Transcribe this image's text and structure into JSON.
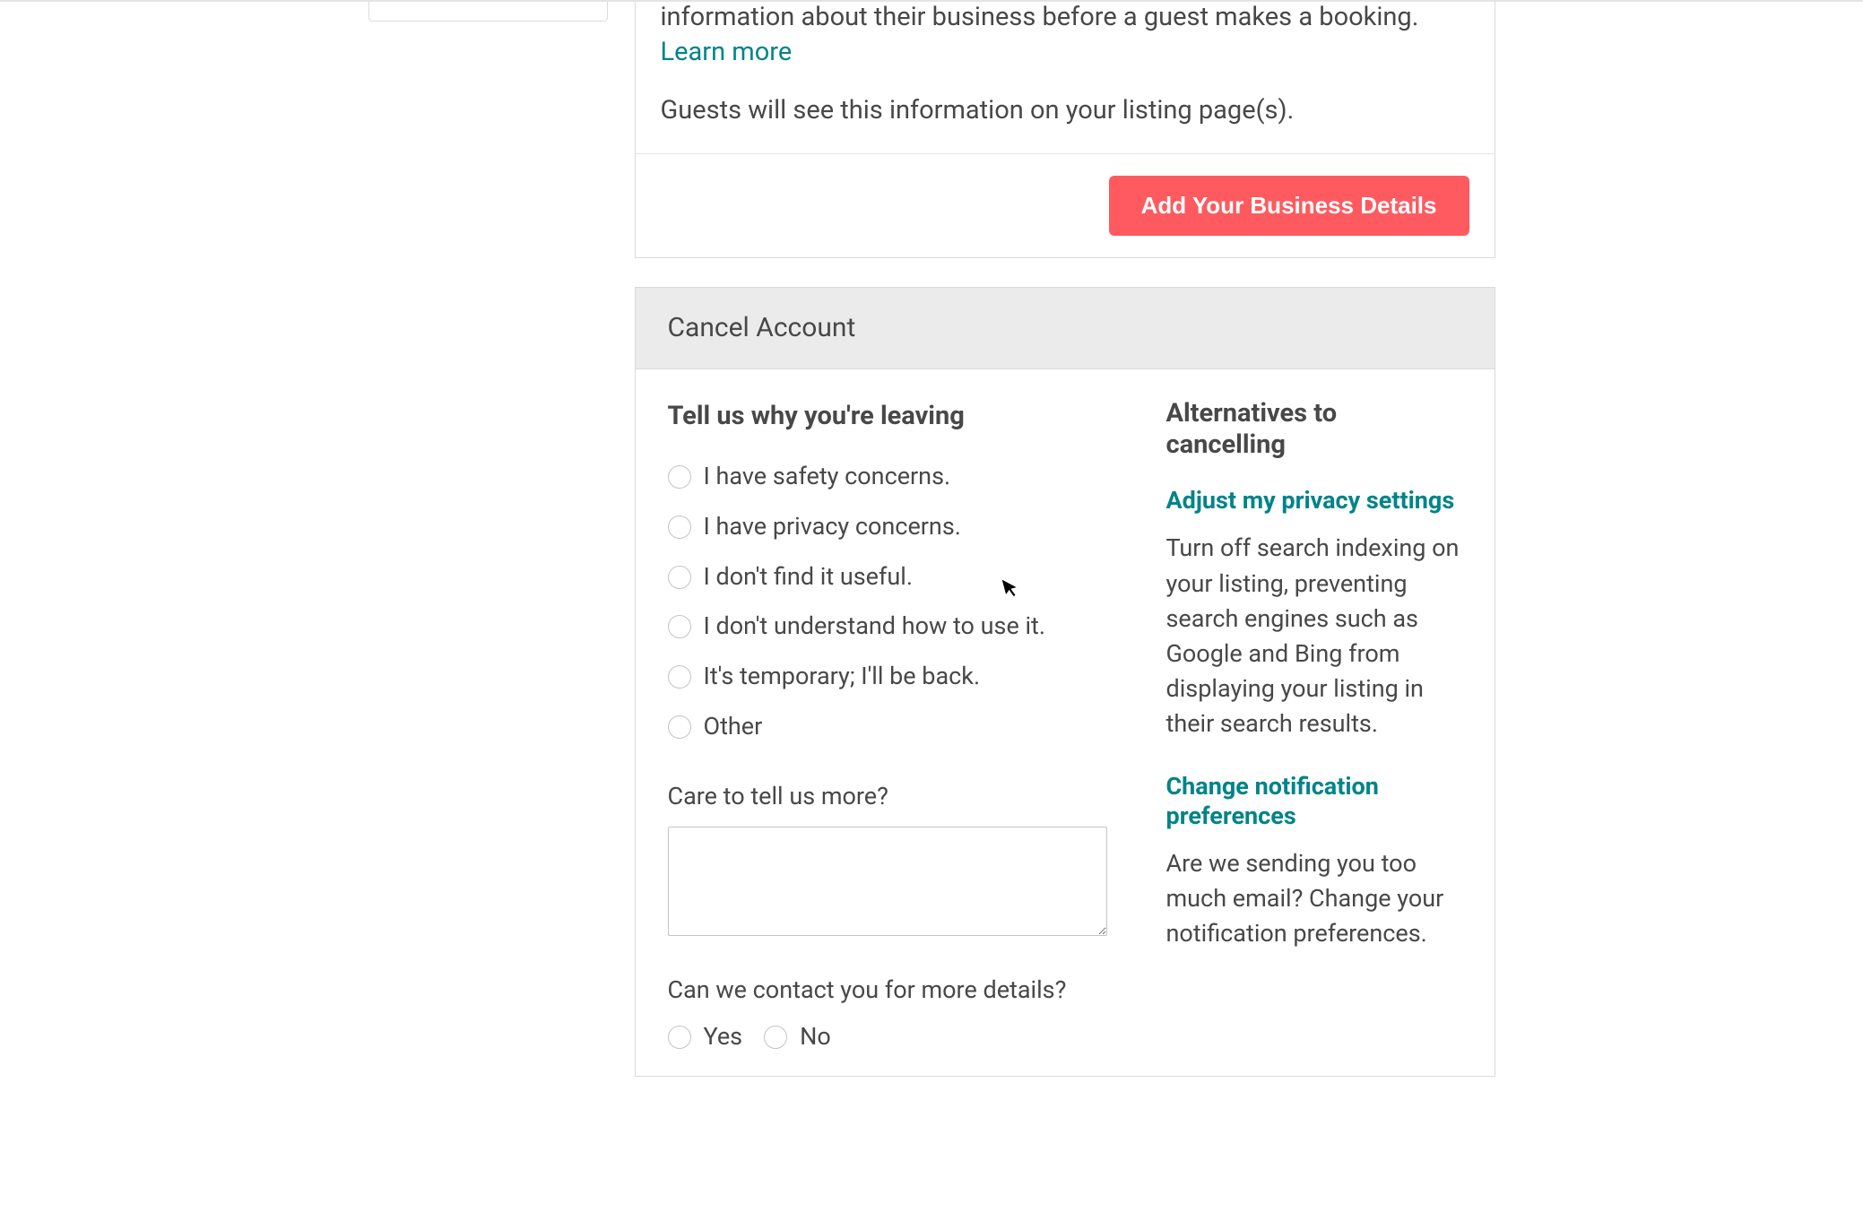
{
  "business_section": {
    "info_text_fragment": "information about their business before a guest makes a booking. ",
    "learn_more": "Learn more",
    "guests_text": "Guests will see this information on your listing page(s).",
    "add_button": "Add Your Business Details"
  },
  "cancel_account": {
    "panel_title": "Cancel Account",
    "leaving_heading": "Tell us why you're leaving",
    "reasons": [
      "I have safety concerns.",
      "I have privacy concerns.",
      "I don't find it useful.",
      "I don't understand how to use it.",
      "It's temporary; I'll be back.",
      "Other"
    ],
    "more_label": "Care to tell us more?",
    "more_value": "",
    "contact_label": "Can we contact you for more details?",
    "contact_options": {
      "yes": "Yes",
      "no": "No"
    },
    "alternatives_heading": "Alternatives to cancelling",
    "alternatives": [
      {
        "link": "Adjust my privacy settings",
        "description": "Turn off search indexing on your listing, preventing search engines such as Google and Bing from displaying your listing in their search results."
      },
      {
        "link": "Change notification preferences",
        "description": "Are we sending you too much email? Change your notification preferences."
      }
    ]
  },
  "colors": {
    "primary_red": "#ff5a5f",
    "link_teal": "#008489"
  }
}
